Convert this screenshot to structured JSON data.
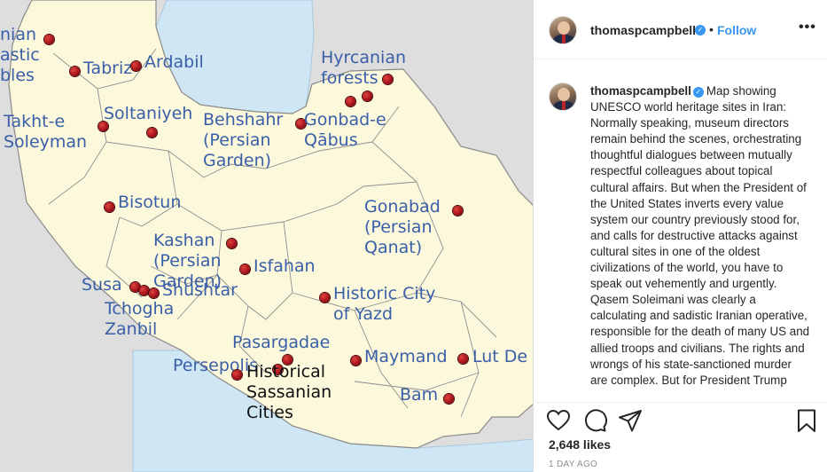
{
  "map": {
    "sites": [
      {
        "id": "armenian-monastic-ensembles",
        "lines": [
          "nian",
          "astic",
          "bles"
        ]
      },
      {
        "id": "tabriz",
        "lines": [
          "Tabriz"
        ]
      },
      {
        "id": "ardabil",
        "lines": [
          "Ardabil"
        ]
      },
      {
        "id": "hyrcanian",
        "lines": [
          "Hyrcanian",
          "forests"
        ]
      },
      {
        "id": "takht-e-soleyman",
        "lines": [
          "Takht-e",
          "Soleyman"
        ]
      },
      {
        "id": "soltaniyeh",
        "lines": [
          "Soltaniyeh"
        ]
      },
      {
        "id": "behshahr",
        "lines": [
          "Behshahr",
          "(Persian",
          "Garden)"
        ]
      },
      {
        "id": "gonbad",
        "lines": [
          "Gonbad-e",
          "Qābus"
        ]
      },
      {
        "id": "bisotun",
        "lines": [
          "Bisotun"
        ]
      },
      {
        "id": "gonabad",
        "lines": [
          "Gonabad",
          "(Persian",
          "Qanat)"
        ]
      },
      {
        "id": "kashan",
        "lines": [
          "Kashan",
          "(Persian",
          "Garden)"
        ]
      },
      {
        "id": "isfahan",
        "lines": [
          "Isfahan"
        ]
      },
      {
        "id": "susa",
        "lines": [
          "Susa"
        ]
      },
      {
        "id": "shushtar",
        "lines": [
          "Shushtar"
        ]
      },
      {
        "id": "tchogha-zanbil",
        "lines": [
          "Tchogha",
          "Zanbil"
        ]
      },
      {
        "id": "yazd",
        "lines": [
          "Historic City",
          "of Yazd"
        ]
      },
      {
        "id": "pasargadae",
        "lines": [
          "Pasargadae"
        ]
      },
      {
        "id": "maymand",
        "lines": [
          "Maymand"
        ]
      },
      {
        "id": "lut",
        "lines": [
          "Lut De"
        ]
      },
      {
        "id": "persepolis",
        "lines": [
          "Persepolis"
        ]
      },
      {
        "id": "sassanian",
        "lines": [
          "Historical",
          "Sassanian",
          "Cities"
        ]
      },
      {
        "id": "bam",
        "lines": [
          "Bam"
        ]
      }
    ]
  },
  "header": {
    "username": "thomaspcampbell",
    "separator": "•",
    "follow_label": "Follow",
    "more_label": "•••"
  },
  "caption": {
    "username": "thomaspcampbell",
    "text": "Map showing UNESCO world heritage sites in Iran: Normally speaking, museum directors remain behind the scenes, orchestrating thoughtful dialogues between mutually respectful colleagues about topical cultural affairs. But when the President of the United States inverts every value system our country previously stood for, and calls for destructive attacks against cultural sites in one of the oldest civilizations of the world, you have to speak out vehemently and urgently. Qasem Soleimani was clearly a calculating and sadistic Iranian operative, responsible for the death of many US and allied troops and civilians. The rights and wrongs of his state-sanctioned murder are complex. But for President Trump"
  },
  "actions": {
    "likes": "2,648 likes",
    "time": "1 DAY AGO"
  },
  "colors": {
    "map_land": "#fbf8dc",
    "map_water": "#cfe7f5",
    "map_neighbor": "#dedede",
    "map_label": "#3a5fa8",
    "link_blue": "#3897f0",
    "verified_blue": "#3897f0",
    "site_marker": "#a9141c"
  },
  "icons": [
    "heart-icon",
    "comment-icon",
    "share-icon",
    "save-icon",
    "verified-badge-icon",
    "more-options-icon"
  ]
}
